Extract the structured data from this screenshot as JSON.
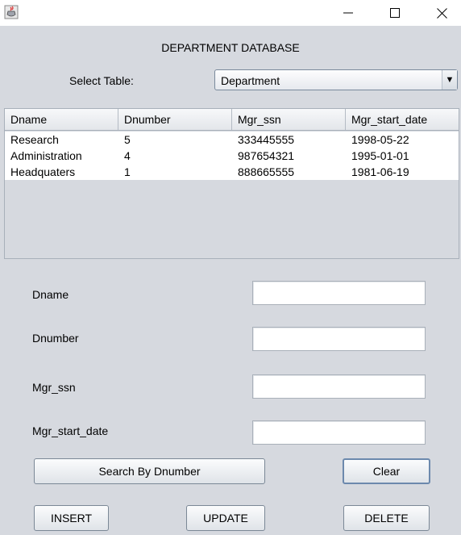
{
  "window": {
    "app_icon": "java-cup-icon",
    "minimize_icon": "minimize-icon",
    "maximize_icon": "maximize-icon",
    "close_icon": "close-icon"
  },
  "header": {
    "title": "DEPARTMENT DATABASE"
  },
  "table_select": {
    "label": "Select Table:",
    "value": "Department"
  },
  "table": {
    "columns": [
      "Dname",
      "Dnumber",
      "Mgr_ssn",
      "Mgr_start_date"
    ],
    "rows": [
      [
        "Research",
        "5",
        "333445555",
        "1998-05-22"
      ],
      [
        "Administration",
        "4",
        "987654321",
        "1995-01-01"
      ],
      [
        "Headquaters",
        "1",
        "888665555",
        "1981-06-19"
      ]
    ]
  },
  "form": {
    "dname_label": "Dname",
    "dnumber_label": "Dnumber",
    "mgr_ssn_label": "Mgr_ssn",
    "mgr_start_date_label": "Mgr_start_date",
    "dname_value": "",
    "dnumber_value": "",
    "mgr_ssn_value": "",
    "mgr_start_date_value": ""
  },
  "buttons": {
    "search": "Search By Dnumber",
    "clear": "Clear",
    "insert": "INSERT",
    "update": "UPDATE",
    "delete": "DELETE"
  }
}
